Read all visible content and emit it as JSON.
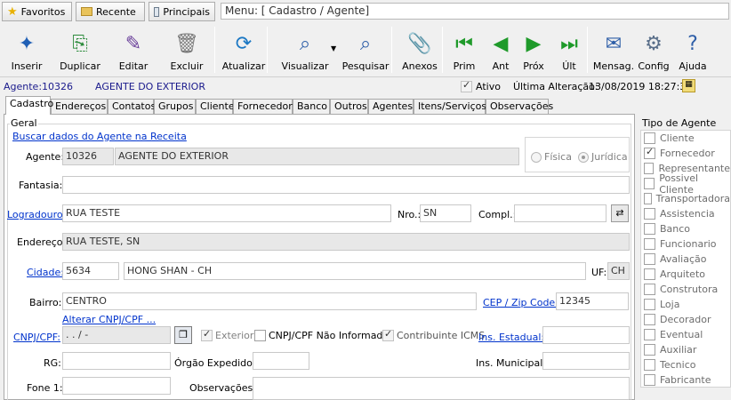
{
  "favbar": {
    "favoritos": "Favoritos",
    "recente": "Recente",
    "principais": "Principais"
  },
  "menu": {
    "label": "Menu: [ Cadastro / Agente]"
  },
  "toolbar": [
    {
      "label": "Inserir",
      "icon": "new-document-icon"
    },
    {
      "label": "Duplicar",
      "icon": "duplicate-icon"
    },
    {
      "label": "Editar",
      "icon": "edit-icon"
    },
    {
      "label": "Excluir",
      "icon": "trash-icon"
    },
    {
      "label": "Atualizar",
      "icon": "refresh-icon"
    },
    {
      "label": "Visualizar",
      "icon": "preview-icon"
    },
    {
      "label": "Pesquisar",
      "icon": "search-icon"
    },
    {
      "label": "Anexos",
      "icon": "attachment-icon"
    },
    {
      "label": "Prim",
      "icon": "first-icon"
    },
    {
      "label": "Ant",
      "icon": "previous-icon"
    },
    {
      "label": "Próx",
      "icon": "next-icon"
    },
    {
      "label": "Últ",
      "icon": "last-icon"
    },
    {
      "label": "Mensag.",
      "icon": "message-icon"
    },
    {
      "label": "Config",
      "icon": "config-icon"
    },
    {
      "label": "Ajuda",
      "icon": "help-icon"
    }
  ],
  "header": {
    "agente_label": "Agente:",
    "agente_code": "10326",
    "agente_name": "AGENTE DO EXTERIOR",
    "ativo": "Ativo",
    "ultima_label": "Última Alteração:",
    "ultima_value": "13/08/2019 18:27:33"
  },
  "tabs": [
    "Cadastro",
    "Endereços",
    "Contatos",
    "Grupos",
    "Cliente",
    "Fornecedor",
    "Banco",
    "Outros",
    "Agentes",
    "Itens/Serviços",
    "Observações"
  ],
  "form": {
    "geral": "Geral",
    "buscar": "Buscar dados do Agente na Receita",
    "agente_label": "Agente:",
    "agente_code": "10326",
    "agente_name": "AGENTE DO EXTERIOR",
    "fisica": "Física",
    "juridica": "Jurídica",
    "fantasia_label": "Fantasia:",
    "fantasia": "",
    "logradouro_label": "Logradouro:",
    "logradouro": "RUA TESTE",
    "nro_label": "Nro.:",
    "nro": "SN",
    "compl_label": "Compl.:",
    "compl": "",
    "endereco_label": "Endereço:",
    "endereco": "RUA TESTE, SN",
    "cidade_label": "Cidade:",
    "cidade_code": "5634",
    "cidade_name": "HONG SHAN - CH",
    "uf_label": "UF:",
    "uf": "CH",
    "bairro_label": "Bairro:",
    "bairro": "CENTRO",
    "cep_label": "CEP / Zip Code:",
    "cep": "12345",
    "alterar": "Alterar CNPJ/CPF ...",
    "cnpj_label": "CNPJ/CPF:",
    "cnpj": ".    .    /    -",
    "exterior": "Exterior",
    "cnpj_nao": "CNPJ/CPF Não Informado",
    "contribuinte": "Contribuinte ICMS",
    "ins_estadual_label": "Ins. Estadual:",
    "ins_estadual": "",
    "rg_label": "RG:",
    "rg": "",
    "orgao_label": "Órgão Expedidor:",
    "orgao": "",
    "ins_municipal_label": "Ins. Municipal:",
    "ins_municipal": "",
    "fone_label": "Fone 1:",
    "fone": "",
    "obs_label": "Observações:",
    "obs": ""
  },
  "tipo": {
    "title": "Tipo de Agente",
    "items": [
      {
        "label": "Cliente",
        "checked": false
      },
      {
        "label": "Fornecedor",
        "checked": true
      },
      {
        "label": "Representante",
        "checked": false
      },
      {
        "label": "Possivel Cliente",
        "checked": false
      },
      {
        "label": "Transportadora",
        "checked": false
      },
      {
        "label": "Assistencia",
        "checked": false
      },
      {
        "label": "Banco",
        "checked": false
      },
      {
        "label": "Funcionario",
        "checked": false
      },
      {
        "label": "Avaliação",
        "checked": false
      },
      {
        "label": "Arquiteto",
        "checked": false
      },
      {
        "label": "Construtora",
        "checked": false
      },
      {
        "label": "Loja",
        "checked": false
      },
      {
        "label": "Decorador",
        "checked": false
      },
      {
        "label": "Eventual",
        "checked": false
      },
      {
        "label": "Auxiliar",
        "checked": false
      },
      {
        "label": "Tecnico",
        "checked": false
      },
      {
        "label": "Fabricante",
        "checked": false
      }
    ]
  }
}
